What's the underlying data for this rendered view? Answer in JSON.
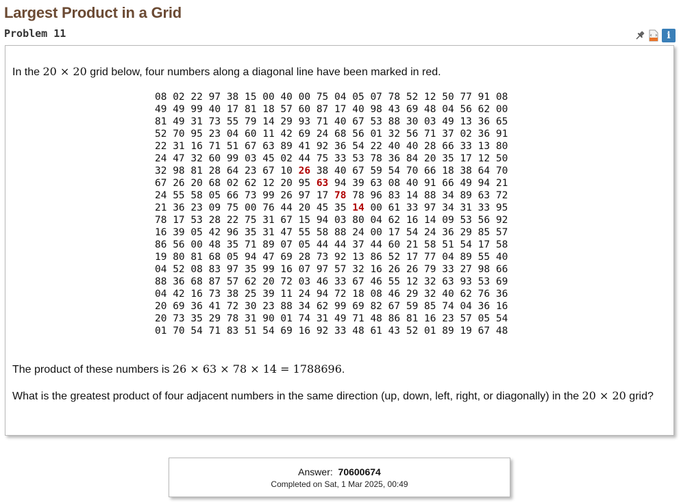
{
  "page": {
    "title": "Largest Product in a Grid",
    "problem_label": "Problem 11"
  },
  "toolbar": {
    "pin_icon": "pin-icon",
    "html_icon": "html-icon",
    "info_label": "i"
  },
  "problem": {
    "intro_before": "In the ",
    "intro_grid_size": "20 × 20",
    "intro_after": " grid below, four numbers along a diagonal line have been marked in red.",
    "grid_rows": [
      "08 02 22 97 38 15 00 40 00 75 04 05 07 78 52 12 50 77 91 08",
      "49 49 99 40 17 81 18 57 60 87 17 40 98 43 69 48 04 56 62 00",
      "81 49 31 73 55 79 14 29 93 71 40 67 53 88 30 03 49 13 36 65",
      "52 70 95 23 04 60 11 42 69 24 68 56 01 32 56 71 37 02 36 91",
      "22 31 16 71 51 67 63 89 41 92 36 54 22 40 40 28 66 33 13 80",
      "24 47 32 60 99 03 45 02 44 75 33 53 78 36 84 20 35 17 12 50",
      "32 98 81 28 64 23 67 10 26 38 40 67 59 54 70 66 18 38 64 70",
      "67 26 20 68 02 62 12 20 95 63 94 39 63 08 40 91 66 49 94 21",
      "24 55 58 05 66 73 99 26 97 17 78 78 96 83 14 88 34 89 63 72",
      "21 36 23 09 75 00 76 44 20 45 35 14 00 61 33 97 34 31 33 95",
      "78 17 53 28 22 75 31 67 15 94 03 80 04 62 16 14 09 53 56 92",
      "16 39 05 42 96 35 31 47 55 58 88 24 00 17 54 24 36 29 85 57",
      "86 56 00 48 35 71 89 07 05 44 44 37 44 60 21 58 51 54 17 58",
      "19 80 81 68 05 94 47 69 28 73 92 13 86 52 17 77 04 89 55 40",
      "04 52 08 83 97 35 99 16 07 97 57 32 16 26 26 79 33 27 98 66",
      "88 36 68 87 57 62 20 72 03 46 33 67 46 55 12 32 63 93 53 69",
      "04 42 16 73 38 25 39 11 24 94 72 18 08 46 29 32 40 62 76 36",
      "20 69 36 41 72 30 23 88 34 62 99 69 82 67 59 85 74 04 36 16",
      "20 73 35 29 78 31 90 01 74 31 49 71 48 86 81 16 23 57 05 54",
      "01 70 54 71 83 51 54 69 16 92 33 48 61 43 52 01 89 19 67 48"
    ],
    "highlighted_cells": [
      {
        "row": 6,
        "col": 8
      },
      {
        "row": 7,
        "col": 9
      },
      {
        "row": 8,
        "col": 10
      },
      {
        "row": 9,
        "col": 11
      }
    ],
    "highlight_color": "#b00000",
    "product_before": "The product of these numbers is ",
    "product_expr": "26 × 63 × 78 × 14 = 1788696",
    "product_after": ".",
    "question_before": "What is the greatest product of four adjacent numbers in the same direction (up, down, left, right, or diagonally) in the ",
    "question_grid_size": "20 × 20",
    "question_after": " grid?"
  },
  "answer": {
    "label": "Answer:",
    "value": "70600674",
    "completed": "Completed on Sat, 1 Mar 2025, 00:49"
  },
  "colors": {
    "title": "#6b4a33",
    "info_button": "#3a7fb8",
    "html_icon": "#e8742a"
  }
}
